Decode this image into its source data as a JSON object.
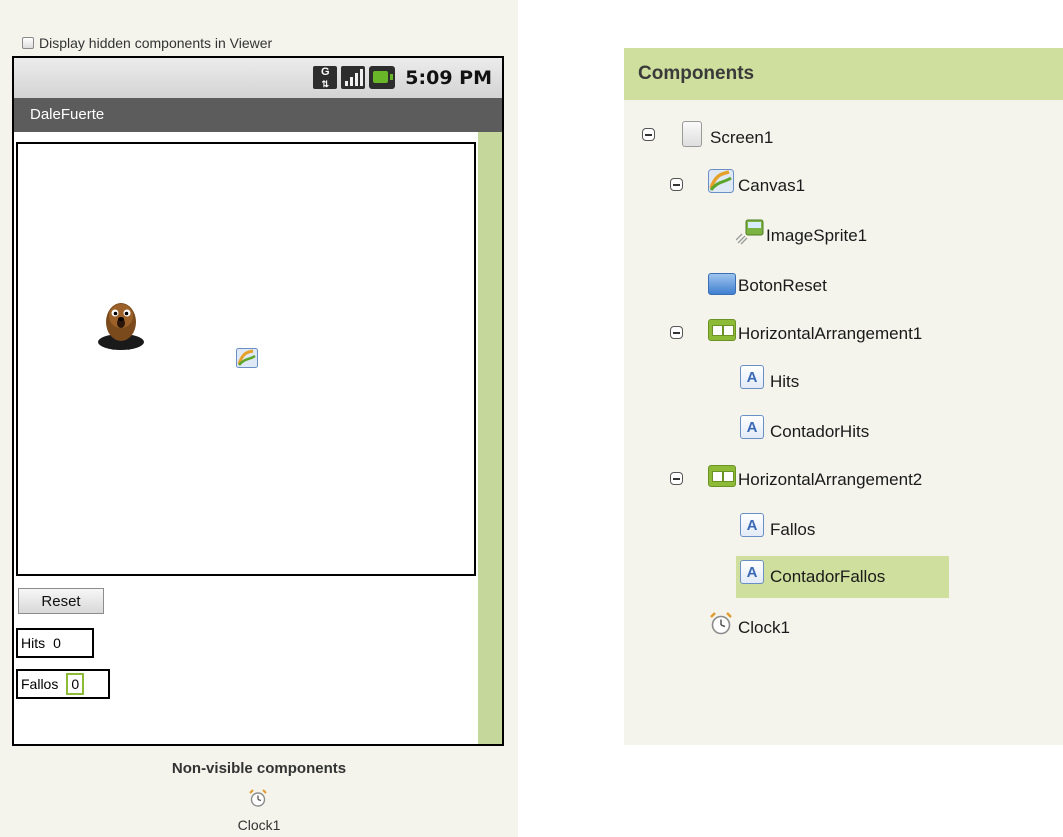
{
  "viewer": {
    "hidden_components_label": "Display hidden components in Viewer",
    "status_bar": {
      "time": "5:09 PM",
      "network_icon": "G",
      "icons": [
        "network-g-icon",
        "signal-bars-icon",
        "battery-icon"
      ]
    },
    "app_title": "DaleFuerte",
    "reset_button_label": "Reset",
    "hits_label": "Hits",
    "hits_value": "0",
    "fallos_label": "Fallos",
    "fallos_value": "0",
    "non_visible_title": "Non-visible components",
    "non_visible_items": [
      {
        "label": "Clock1",
        "icon": "clock-icon"
      }
    ]
  },
  "components": {
    "title": "Components",
    "tree": [
      {
        "label": "Screen1",
        "icon": "screen-icon",
        "level": 0,
        "expanded": true
      },
      {
        "label": "Canvas1",
        "icon": "canvas-icon",
        "level": 1,
        "expanded": true
      },
      {
        "label": "ImageSprite1",
        "icon": "imagesprite-icon",
        "level": 2
      },
      {
        "label": "BotonReset",
        "icon": "button-icon",
        "level": 1
      },
      {
        "label": "HorizontalArrangement1",
        "icon": "horizontal-arrangement-icon",
        "level": 1,
        "expanded": true
      },
      {
        "label": "Hits",
        "icon": "label-icon",
        "level": 2
      },
      {
        "label": "ContadorHits",
        "icon": "label-icon",
        "level": 2
      },
      {
        "label": "HorizontalArrangement2",
        "icon": "horizontal-arrangement-icon",
        "level": 1,
        "expanded": true
      },
      {
        "label": "Fallos",
        "icon": "label-icon",
        "level": 2
      },
      {
        "label": "ContadorFallos",
        "icon": "label-icon",
        "level": 2,
        "selected": true
      },
      {
        "label": "Clock1",
        "icon": "clock-icon",
        "level": 1
      }
    ]
  },
  "colors": {
    "accent_green": "#cfdf9d",
    "titlebar_gray": "#5c5c5c",
    "selection_border": "#8dbb38"
  }
}
